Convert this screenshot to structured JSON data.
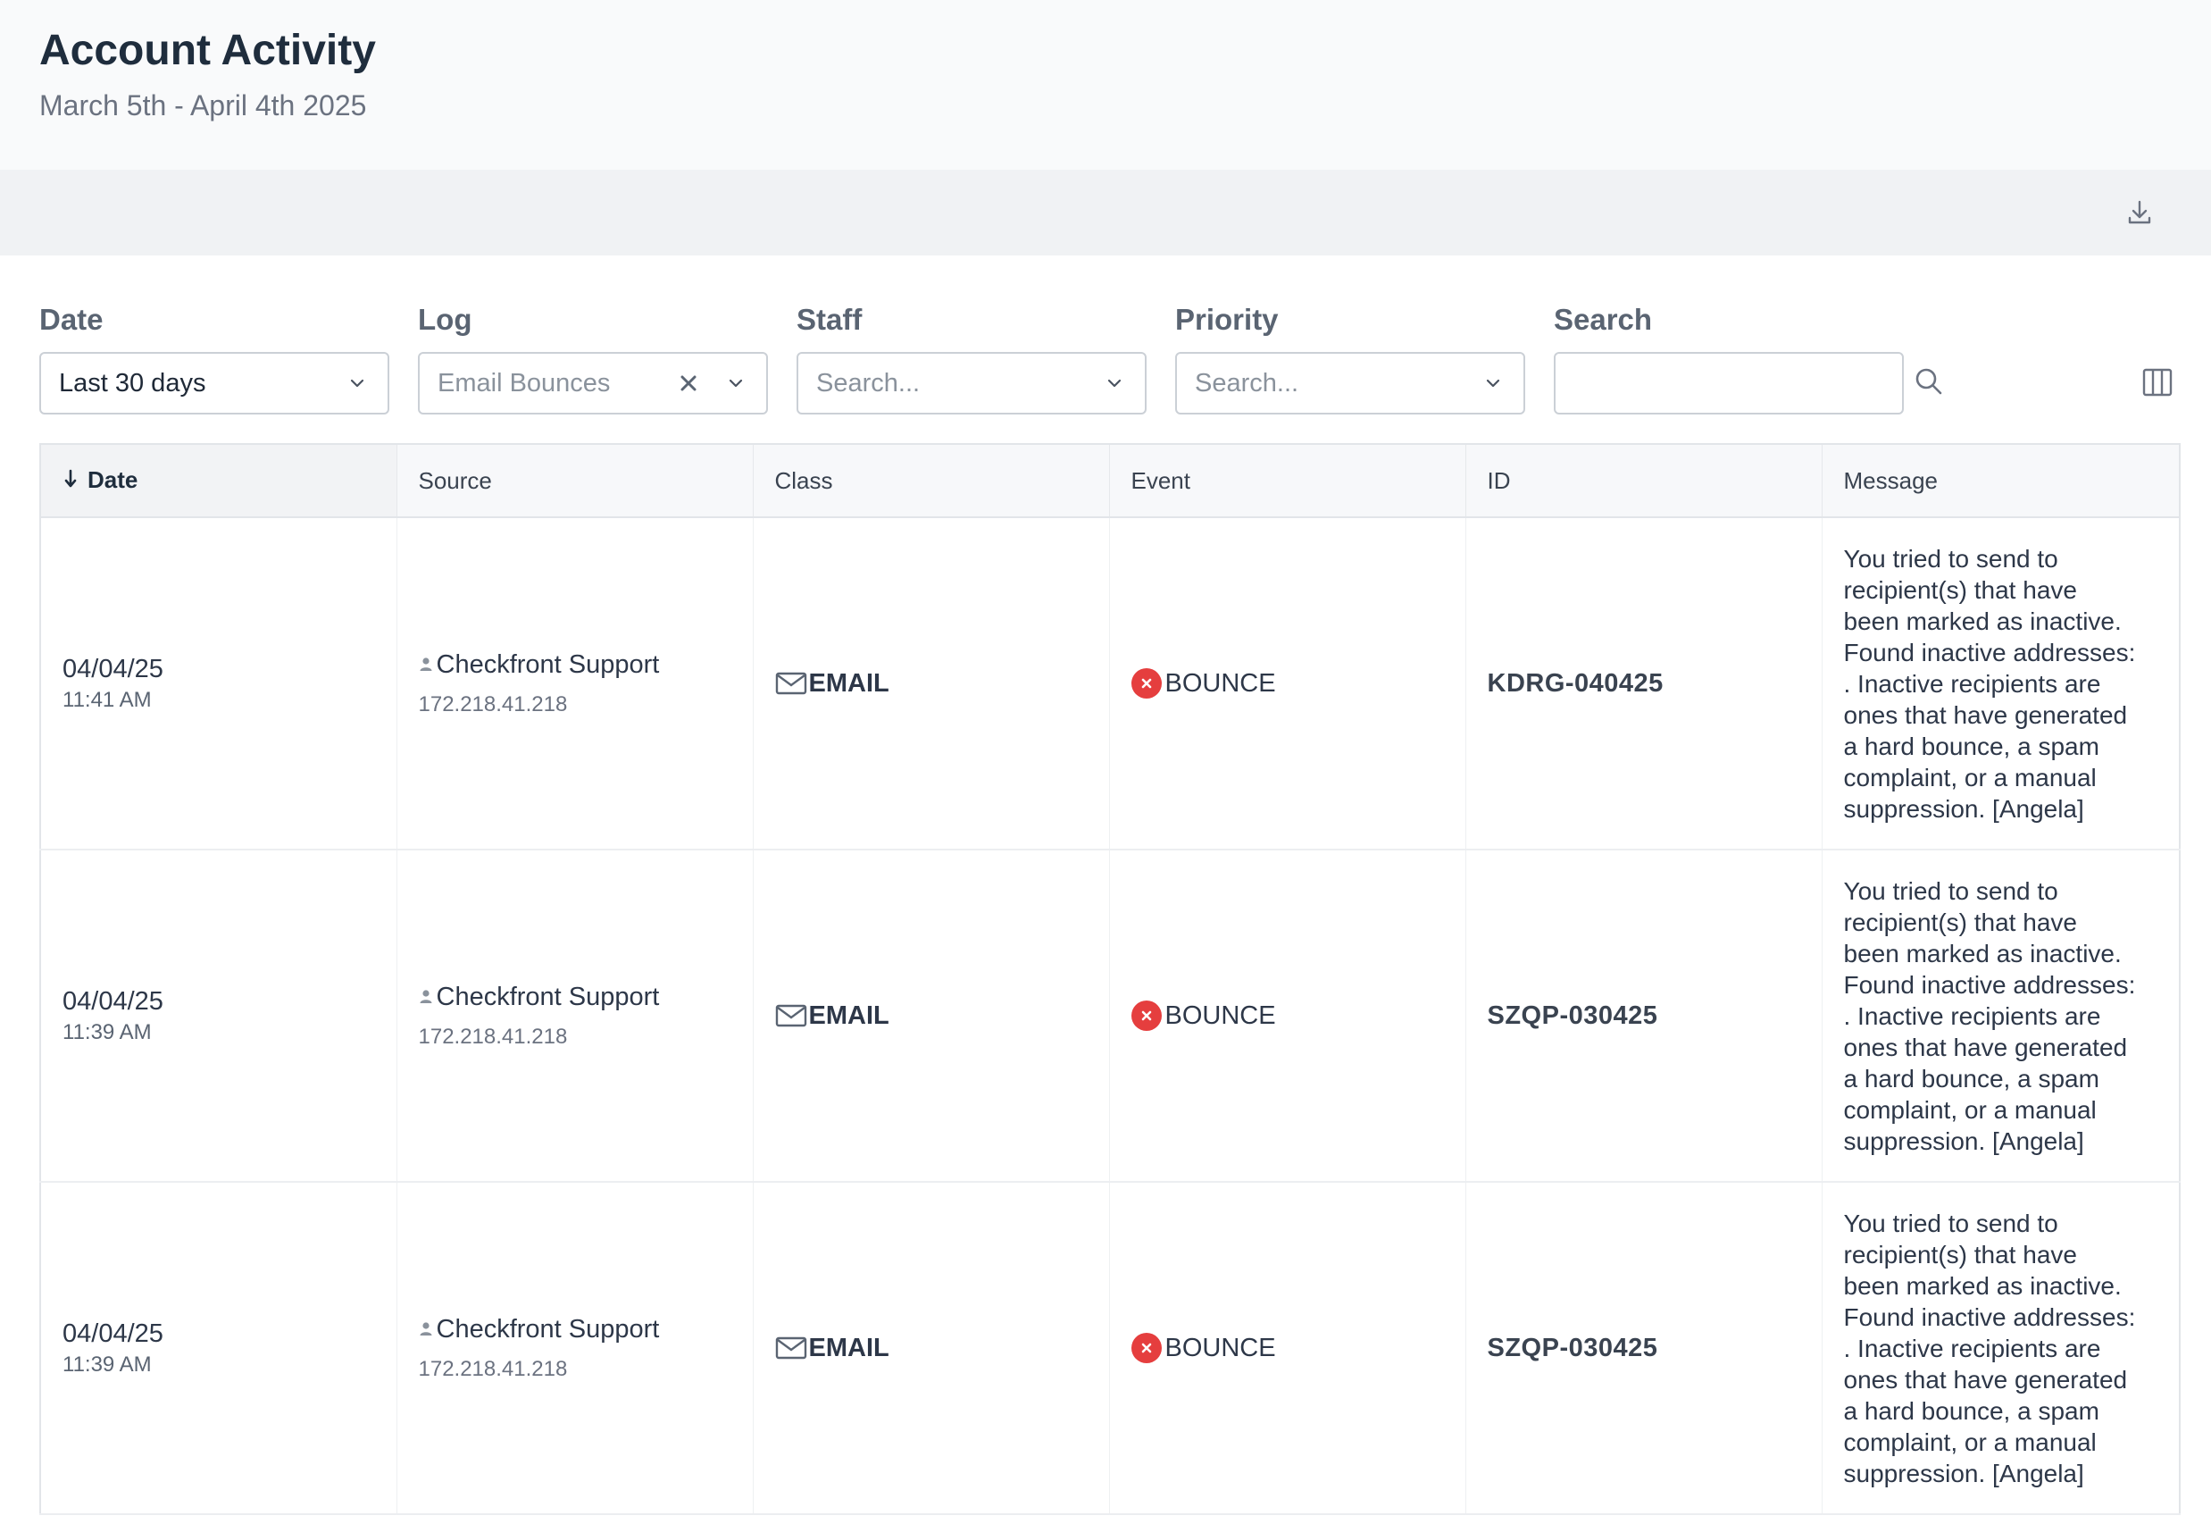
{
  "header": {
    "title": "Account Activity",
    "subtitle": "March 5th - April 4th 2025"
  },
  "toolbar": {
    "download_icon": "download-icon"
  },
  "filters": {
    "date": {
      "label": "Date",
      "value": "Last 30 days"
    },
    "log": {
      "label": "Log",
      "value": "Email Bounces"
    },
    "staff": {
      "label": "Staff",
      "placeholder": "Search..."
    },
    "priority": {
      "label": "Priority",
      "placeholder": "Search..."
    },
    "search": {
      "label": "Search",
      "value": ""
    }
  },
  "table": {
    "columns": [
      "Date",
      "Source",
      "Class",
      "Event",
      "ID",
      "Message"
    ],
    "rows": [
      {
        "date": "04/04/25",
        "time": "11:41 AM",
        "source": "Checkfront Support",
        "ip": "172.218.41.218",
        "class": "EMAIL",
        "event": "BOUNCE",
        "id": "KDRG-040425",
        "message": "You tried to send to recipient(s) that have been marked as inactive. Found inactive addresses: . Inactive recipients are ones that have generated a hard bounce, a spam complaint, or a manual suppression. [Angela]"
      },
      {
        "date": "04/04/25",
        "time": "11:39 AM",
        "source": "Checkfront Support",
        "ip": "172.218.41.218",
        "class": "EMAIL",
        "event": "BOUNCE",
        "id": "SZQP-030425",
        "message": "You tried to send to recipient(s) that have been marked as inactive. Found inactive addresses: . Inactive recipients are ones that have generated a hard bounce, a spam complaint, or a manual suppression. [Angela]"
      },
      {
        "date": "04/04/25",
        "time": "11:39 AM",
        "source": "Checkfront Support",
        "ip": "172.218.41.218",
        "class": "EMAIL",
        "event": "BOUNCE",
        "id": "SZQP-030425",
        "message": "You tried to send to recipient(s) that have been marked as inactive. Found inactive addresses: . Inactive recipients are ones that have generated a hard bounce, a spam complaint, or a manual suppression. [Angela]"
      }
    ]
  },
  "colors": {
    "bounce": "#e53e3e",
    "header_bg": "#f9fafb",
    "toolbar_bg": "#f0f2f4"
  }
}
